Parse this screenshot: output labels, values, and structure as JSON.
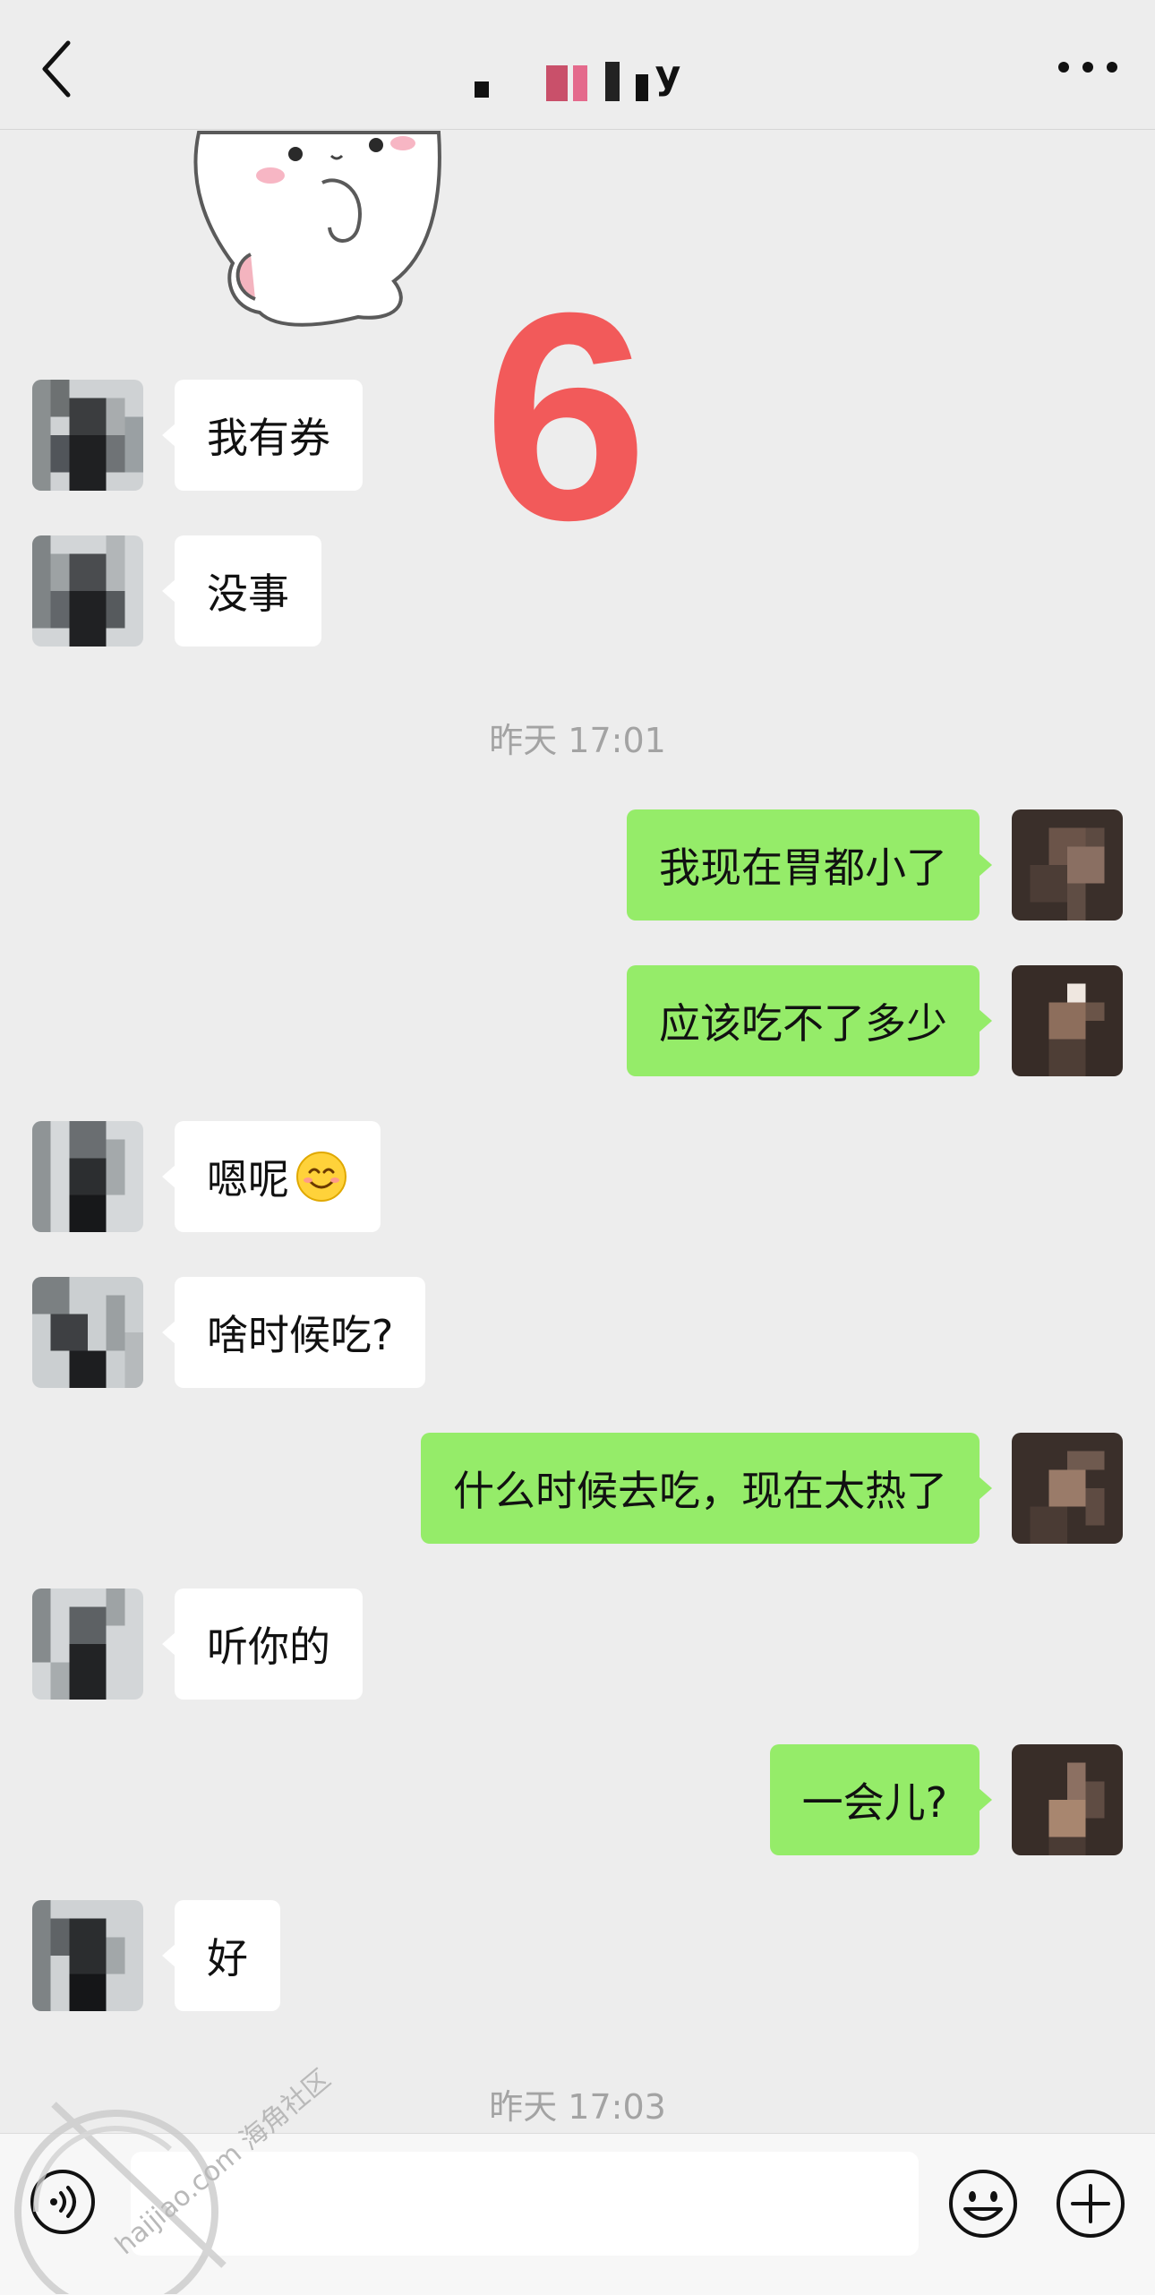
{
  "header": {
    "title": "y",
    "back_icon": "chevron-left-icon",
    "more_icon": "more-dots-icon"
  },
  "overlay": {
    "big_number": "6",
    "color": "#f25a5a"
  },
  "messages": [
    {
      "side": "in",
      "text": "我有券"
    },
    {
      "side": "in",
      "text": "没事"
    },
    {
      "side": "out",
      "text": "我现在胃都小了"
    },
    {
      "side": "out",
      "text": "应该吃不了多少"
    },
    {
      "side": "in",
      "text": "嗯呢",
      "emoji": "smiling-face-icon"
    },
    {
      "side": "in",
      "text": "啥时候吃?"
    },
    {
      "side": "out",
      "text": "什么时候去吃，现在太热了"
    },
    {
      "side": "in",
      "text": "听你的"
    },
    {
      "side": "out",
      "text": "一会儿?"
    },
    {
      "side": "in",
      "text": "好"
    }
  ],
  "timestamps": {
    "first": "昨天 17:01",
    "second": "昨天 17:03"
  },
  "input_bar": {
    "voice_icon": "voice-icon",
    "input_value": "",
    "emoji_icon": "smile-icon",
    "plus_icon": "plus-circle-icon"
  },
  "watermark": {
    "text": "haijiao.com 海角社区"
  },
  "colors": {
    "background": "#ededed",
    "outgoing": "#95ec69",
    "incoming": "#ffffff"
  }
}
